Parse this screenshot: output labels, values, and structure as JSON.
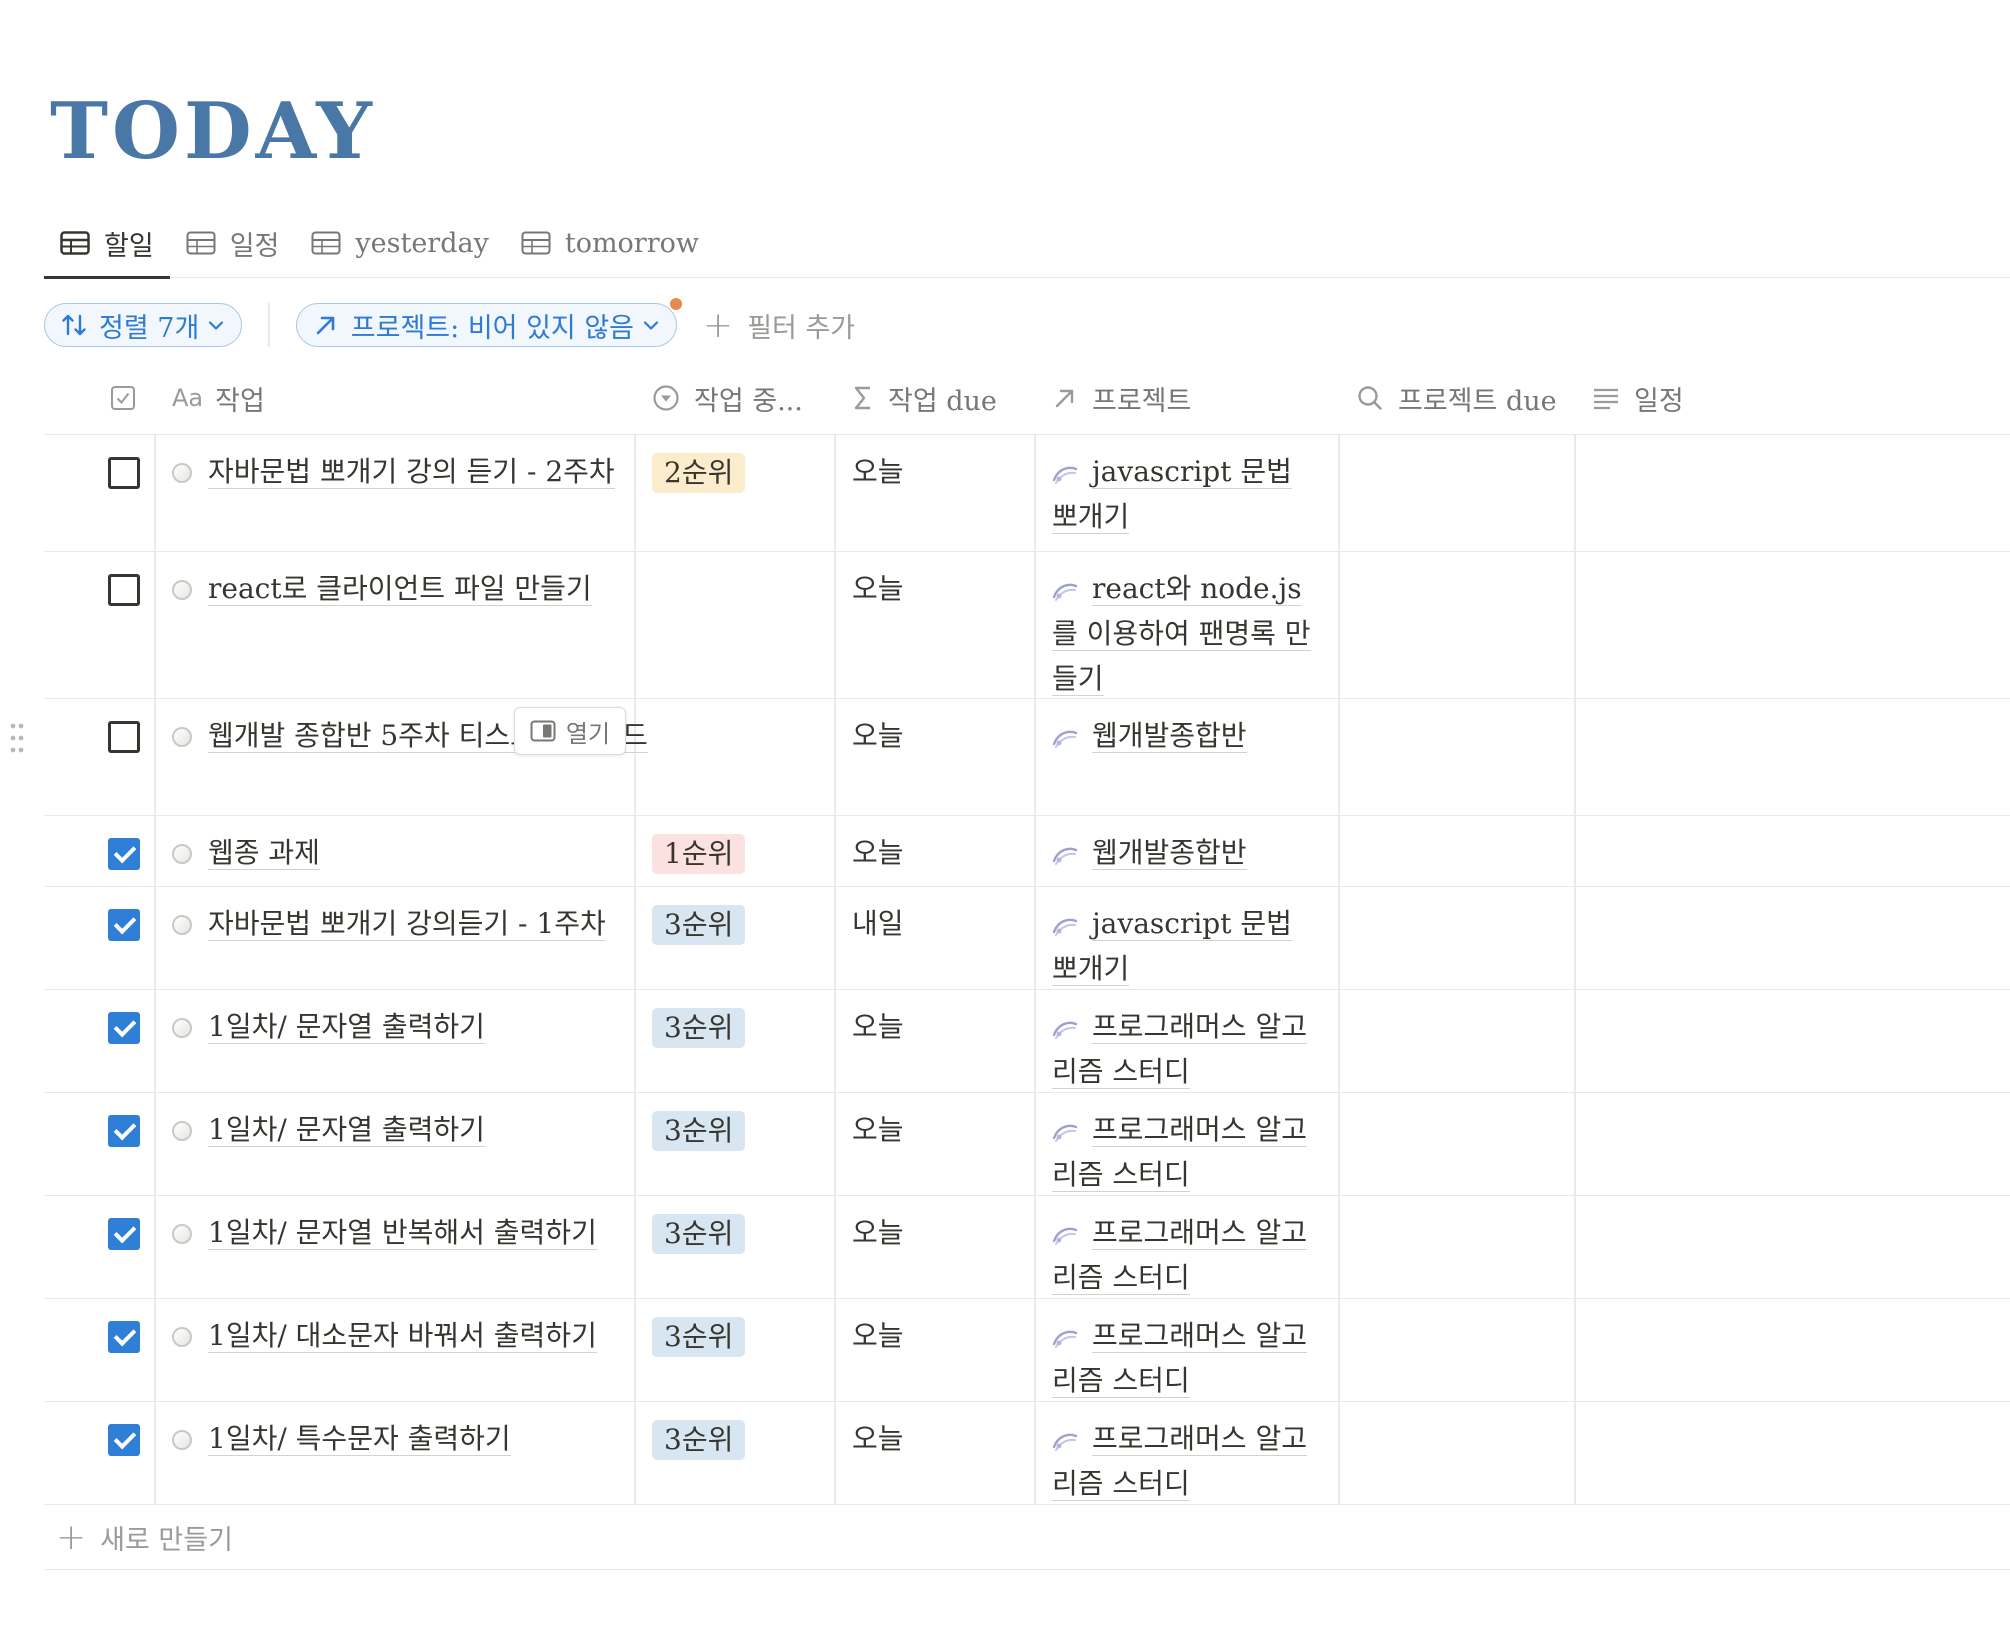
{
  "page": {
    "title": "TODAY"
  },
  "tabs": [
    {
      "label": "할일",
      "active": true
    },
    {
      "label": "일정",
      "active": false
    },
    {
      "label": "yesterday",
      "active": false
    },
    {
      "label": "tomorrow",
      "active": false
    }
  ],
  "filters": {
    "sort_label": "정렬 7개",
    "project_filter_label": "프로젝트: 비어 있지 않음",
    "add_filter_label": "필터 추가"
  },
  "columns": {
    "task": "작업",
    "priority": "작업 중...",
    "due": "작업 due",
    "project": "프로젝트",
    "project_due": "프로젝트 due",
    "schedule": "일정"
  },
  "hover": {
    "open_label": "열기"
  },
  "rows": [
    {
      "done": false,
      "task": "자바문법 뽀개기 강의 듣기 - 2주차",
      "priority": "2순위",
      "due": "오늘",
      "project": "javascript 문법 뽀개기"
    },
    {
      "done": false,
      "task": "react로 클라이언트 파일 만들기",
      "priority": "",
      "due": "오늘",
      "project": "react와 node.js를 이용하여 팬명록 만들기"
    },
    {
      "done": false,
      "task": "웹개발 종합반 5주차 티스토리 업로드",
      "priority": "",
      "due": "오늘",
      "project": "웹개발종합반"
    },
    {
      "done": true,
      "task": "웹종 과제",
      "priority": "1순위",
      "due": "오늘",
      "project": "웹개발종합반"
    },
    {
      "done": true,
      "task": "자바문법 뽀개기 강의듣기 - 1주차",
      "priority": "3순위",
      "due": "내일",
      "project": "javascript 문법 뽀개기"
    },
    {
      "done": true,
      "task": "1일차/ 문자열 출력하기",
      "priority": "3순위",
      "due": "오늘",
      "project": "프로그래머스 알고리즘 스터디"
    },
    {
      "done": true,
      "task": "1일차/ 문자열 출력하기",
      "priority": "3순위",
      "due": "오늘",
      "project": "프로그래머스 알고리즘 스터디"
    },
    {
      "done": true,
      "task": "1일차/ 문자열 반복해서 출력하기",
      "priority": "3순위",
      "due": "오늘",
      "project": "프로그래머스 알고리즘 스터디"
    },
    {
      "done": true,
      "task": "1일차/ 대소문자 바꿔서 출력하기",
      "priority": "3순위",
      "due": "오늘",
      "project": "프로그래머스 알고리즘 스터디"
    },
    {
      "done": true,
      "task": "1일차/ 특수문자 출력하기",
      "priority": "3순위",
      "due": "오늘",
      "project": "프로그래머스 알고리즘 스터디"
    }
  ],
  "new_row_label": "새로 만들기",
  "colors": {
    "title": "#4a78a6",
    "accent": "#2f7fd6",
    "priority_1": "#fbe2e0",
    "priority_2": "#fbeccb",
    "priority_3": "#d7e6f1"
  }
}
